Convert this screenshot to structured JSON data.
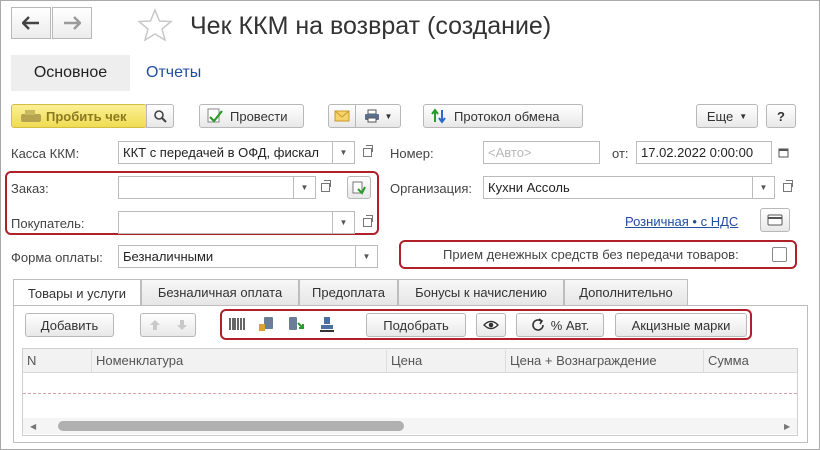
{
  "window": {
    "title": "Чек ККМ на возврат (создание)",
    "star_icon": "star-icon",
    "back_icon": "arrow-left-icon",
    "forward_icon": "arrow-right-icon"
  },
  "sections": {
    "main_label": "Основное",
    "reports_label": "Отчеты"
  },
  "toolbar": {
    "punch_check_label": "Пробить чек",
    "post_label": "Провести",
    "exchange_protocol_label": "Протокол обмена",
    "more_label": "Еще",
    "help_label": "?"
  },
  "form": {
    "kassa_label": "Касса ККМ:",
    "kassa_value": "ККТ с передачей в ОФД, фискал",
    "number_label": "Номер:",
    "number_placeholder": "<Авто>",
    "date_from_label": "от:",
    "date_value": "17.02.2022  0:00:00",
    "order_label": "Заказ:",
    "order_value": "",
    "organization_label": "Организация:",
    "organization_value": "Кухни Ассоль",
    "buyer_label": "Покупатель:",
    "buyer_value": "",
    "retail_vat_link": "Розничная • с НДС",
    "payment_form_label": "Форма оплаты:",
    "payment_form_value": "Безналичными",
    "cash_without_goods_label": "Прием денежных средств без передачи товаров:",
    "cash_without_goods_checked": false
  },
  "tabs": [
    {
      "label": "Товары и услуги",
      "active": true
    },
    {
      "label": "Безналичная оплата",
      "active": false
    },
    {
      "label": "Предоплата",
      "active": false
    },
    {
      "label": "Бонусы к начислению",
      "active": false
    },
    {
      "label": "Дополнительно",
      "active": false
    }
  ],
  "table_toolbar": {
    "add_label": "Добавить",
    "pick_label": "Подобрать",
    "percent_auto_label": "% Авт.",
    "excise_marks_label": "Акцизные марки"
  },
  "table": {
    "columns": [
      "N",
      "Номенклатура",
      "Цена",
      "Цена + Вознаграждение",
      "Сумма"
    ]
  },
  "colors": {
    "highlight_red": "#b0202a",
    "punch_button_yellow": "#f6e36a",
    "link_blue": "#1f4ea3"
  }
}
